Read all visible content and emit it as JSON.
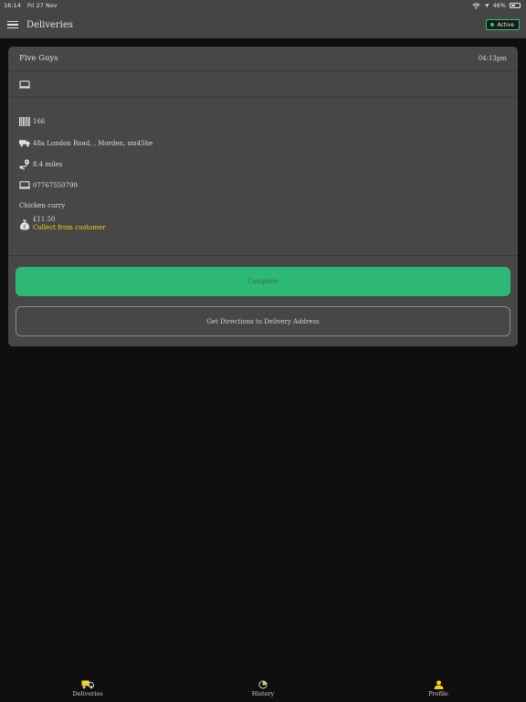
{
  "status_bar": {
    "time": "16:14",
    "date": "Fri 27 Nov",
    "battery": "46%"
  },
  "header": {
    "title": "Deliveries",
    "status_badge": "Active"
  },
  "order": {
    "restaurant": "Five Guys",
    "time": "04:13pm",
    "order_number": "166",
    "address": "48a London Road, , Morden, sm45he",
    "distance": "8.4 miles",
    "phone": "07767550799",
    "items": "Chicken curry",
    "amount": "£11.50",
    "payment_note": "Collect from customer"
  },
  "actions": {
    "complete_label": "Complete",
    "directions_label": "Get Directions to Delivery Address"
  },
  "tabs": [
    {
      "label": "Deliveries",
      "icon": "truck-icon"
    },
    {
      "label": "History",
      "icon": "clock-icon"
    },
    {
      "label": "Profile",
      "icon": "person-icon"
    }
  ],
  "colors": {
    "accent_green": "#2eb876",
    "collect_yellow": "#f2d21c",
    "card_bg": "#474747",
    "page_bg": "#0f0f0f"
  }
}
